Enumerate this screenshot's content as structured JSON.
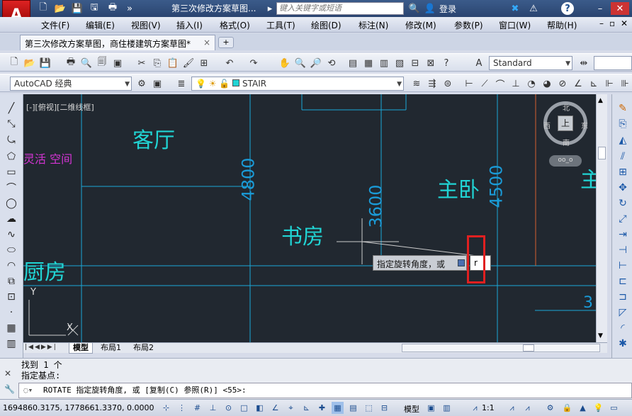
{
  "app": {
    "logo_letter": "A",
    "title": "第三次修改方案草图...",
    "search_placeholder": "键入关键字或短语",
    "login": "登录",
    "help": "?"
  },
  "menu": [
    "文件(F)",
    "编辑(E)",
    "视图(V)",
    "插入(I)",
    "格式(O)",
    "工具(T)",
    "绘图(D)",
    "标注(N)",
    "修改(M)",
    "参数(P)",
    "窗口(W)",
    "帮助(H)"
  ],
  "document_tab": {
    "label": "第三次修改方案草图，商住楼建筑方案草图*",
    "close": "×"
  },
  "toolbar": {
    "text_style": "Standard",
    "workspace": "AutoCAD 经典",
    "layer": "STAIR"
  },
  "viewport": {
    "label": "[-][俯视][二维线框]"
  },
  "viewcube": {
    "north": "北",
    "south": "南",
    "east": "东",
    "west": "西",
    "top": "上",
    "wcs": "oo_o"
  },
  "drawing": {
    "rooms": [
      "客厅",
      "灵活 空间",
      "主卧",
      "书房",
      "厨房",
      "主"
    ],
    "dims": [
      "4800",
      "3600",
      "4500",
      "3"
    ],
    "ucs_y": "Y",
    "ucs_x": "X"
  },
  "tooltip": {
    "prompt": "指定旋转角度，或",
    "input_value": "r"
  },
  "layout_tabs": [
    "模型",
    "布局1",
    "布局2"
  ],
  "command": {
    "history": [
      "找到 1 个",
      "指定基点:"
    ],
    "current": "ROTATE 指定旋转角度, 或 [复制(C) 参照(R)] <55>:"
  },
  "status": {
    "coords": "1694860.3175, 1778661.3370, 0.0000",
    "model": "模型",
    "scale": "1:1"
  },
  "colors": {
    "canvas": "#212830",
    "cad_text": "#21d4d4",
    "highlight": "#e02020"
  }
}
